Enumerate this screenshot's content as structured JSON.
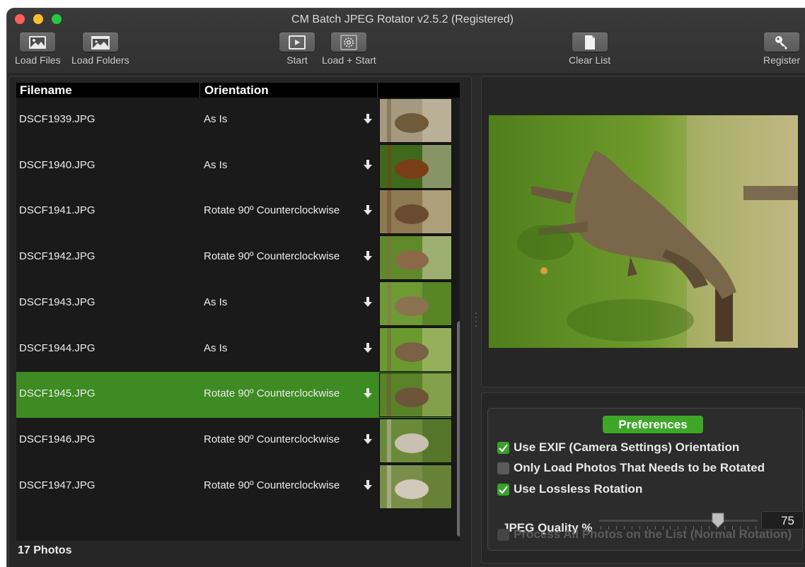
{
  "window": {
    "title": "CM Batch JPEG Rotator v2.5.2 (Registered)"
  },
  "toolbar": {
    "load_files": "Load Files",
    "load_folders": "Load Folders",
    "start": "Start",
    "load_start": "Load + Start",
    "clear_list": "Clear List",
    "register": "Register"
  },
  "table": {
    "columns": {
      "filename": "Filename",
      "orientation": "Orientation"
    },
    "rows": [
      {
        "filename": "DSCF1939.JPG",
        "orientation": "As Is"
      },
      {
        "filename": "DSCF1940.JPG",
        "orientation": "As Is"
      },
      {
        "filename": "DSCF1941.JPG",
        "orientation": "Rotate 90º Counterclockwise"
      },
      {
        "filename": "DSCF1942.JPG",
        "orientation": "Rotate 90º Counterclockwise"
      },
      {
        "filename": "DSCF1943.JPG",
        "orientation": "As Is"
      },
      {
        "filename": "DSCF1944.JPG",
        "orientation": "As Is"
      },
      {
        "filename": "DSCF1945.JPG",
        "orientation": "Rotate 90º Counterclockwise",
        "selected": true
      },
      {
        "filename": "DSCF1946.JPG",
        "orientation": "Rotate 90º Counterclockwise"
      },
      {
        "filename": "DSCF1947.JPG",
        "orientation": "Rotate 90º Counterclockwise"
      }
    ],
    "count_label": "17 Photos"
  },
  "preferences": {
    "title": "Preferences",
    "use_exif": {
      "label": "Use EXIF (Camera Settings) Orientation",
      "checked": true
    },
    "only_load": {
      "label": "Only Load Photos That Needs to be Rotated",
      "checked": false
    },
    "lossless": {
      "label": "Use Lossless Rotation",
      "checked": true
    },
    "jpeg_quality_label": "JPEG Quality %",
    "jpeg_quality_value": "75",
    "process_all": {
      "label": "Process All Photos on the List (Normal Rotation)",
      "checked": false,
      "disabled": true
    }
  },
  "colors": {
    "selection": "#3d8b22",
    "prefs_header": "#3ea728",
    "checkbox_on": "#38a12a",
    "window_bg": "#2b2b2b"
  },
  "icons": {
    "load_files": "photo-icon",
    "load_folders": "folder-photo-icon",
    "start": "play-icon",
    "load_start": "gear-icon",
    "clear_list": "blank-document-icon",
    "register": "key-icon",
    "orientation_menu": "arrow-down-icon"
  }
}
